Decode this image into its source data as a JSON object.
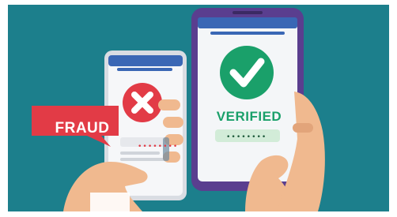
{
  "fraud_label": "FRAUD",
  "verified_label": "VERIFIED",
  "fraud_code": "••••••••",
  "verified_code": "••••••••",
  "colors": {
    "background": "#1c7f8c",
    "fraud_red": "#e23b46",
    "verified_green": "#1aa06a",
    "phone_purple": "#5a3e8f",
    "skin": "#f0b98f"
  },
  "icons": [
    "x-icon",
    "checkmark-icon"
  ]
}
